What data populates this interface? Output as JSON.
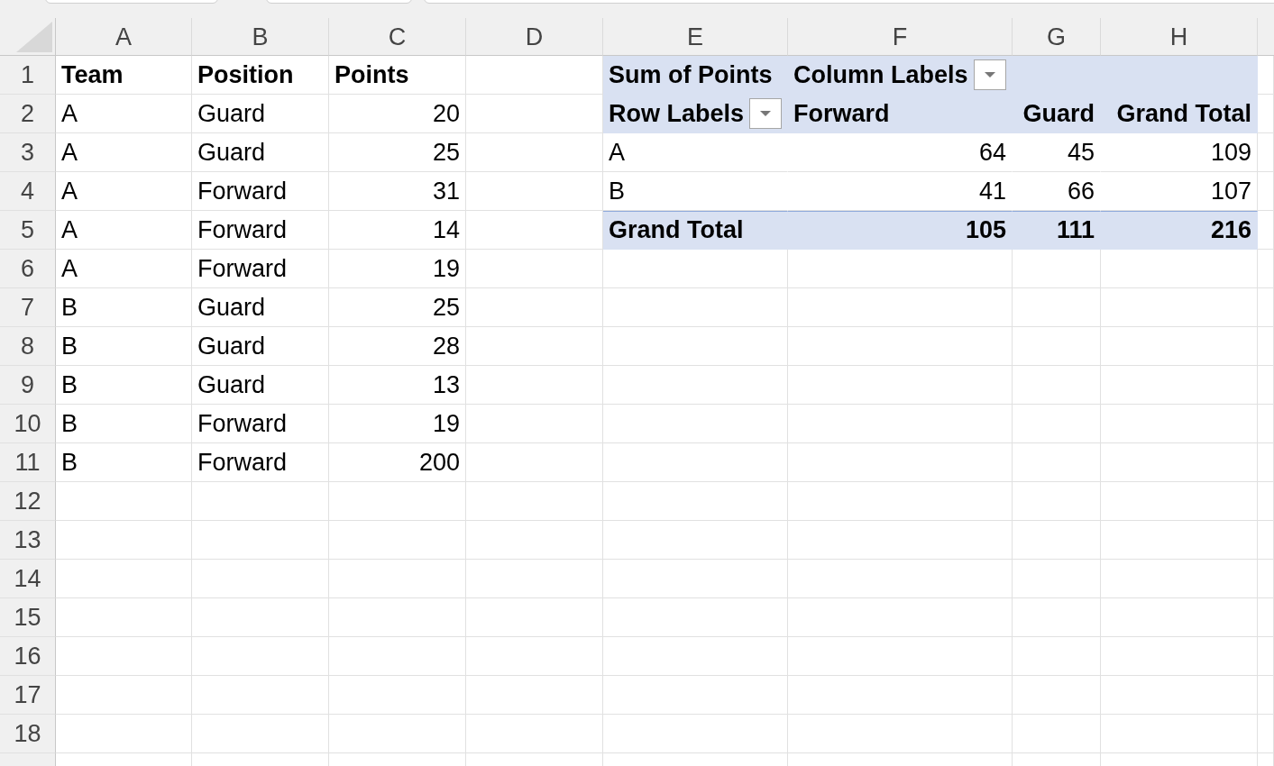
{
  "column_headers": [
    "A",
    "B",
    "C",
    "D",
    "E",
    "F",
    "G",
    "H"
  ],
  "row_numbers": [
    "1",
    "2",
    "3",
    "4",
    "5",
    "6",
    "7",
    "8",
    "9",
    "10",
    "11",
    "12",
    "13",
    "14",
    "15",
    "16",
    "17",
    "18"
  ],
  "data_table": {
    "columns": [
      "Team",
      "Position",
      "Points"
    ],
    "rows": [
      [
        "A",
        "Guard",
        "20"
      ],
      [
        "A",
        "Guard",
        "25"
      ],
      [
        "A",
        "Forward",
        "31"
      ],
      [
        "A",
        "Forward",
        "14"
      ],
      [
        "A",
        "Forward",
        "19"
      ],
      [
        "B",
        "Guard",
        "25"
      ],
      [
        "B",
        "Guard",
        "28"
      ],
      [
        "B",
        "Guard",
        "13"
      ],
      [
        "B",
        "Forward",
        "19"
      ],
      [
        "B",
        "Forward",
        "200"
      ]
    ]
  },
  "pivot_table": {
    "value_field": "Sum of Points",
    "column_labels_header": "Column Labels",
    "row_labels_header": "Row Labels",
    "column_items": [
      "Forward",
      "Guard",
      "Grand Total"
    ],
    "rows": [
      {
        "label": "A",
        "values": [
          "64",
          "45",
          "109"
        ]
      },
      {
        "label": "B",
        "values": [
          "41",
          "66",
          "107"
        ]
      }
    ],
    "grand_total": {
      "label": "Grand Total",
      "values": [
        "105",
        "111",
        "216"
      ]
    }
  }
}
